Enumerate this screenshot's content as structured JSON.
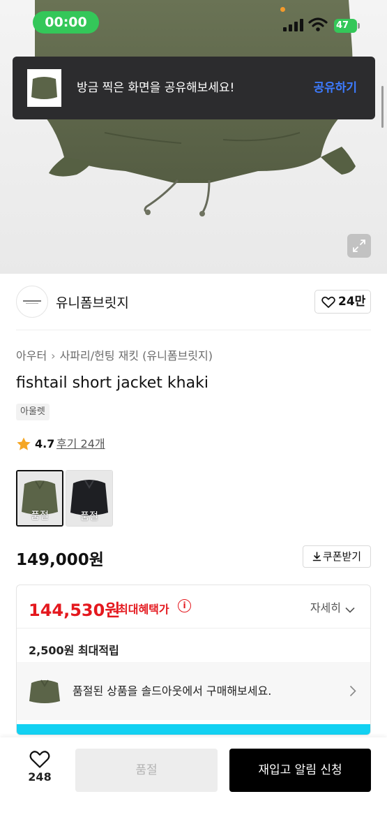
{
  "status_bar": {
    "time": "00:00",
    "battery": "47"
  },
  "toast": {
    "message": "방금 찍은 화면을 공유해보세요!",
    "action": "공유하기"
  },
  "brand": {
    "name": "유니폼브릿지",
    "likes": "24만"
  },
  "breadcrumb": [
    "아우터",
    "사파리/헌팅 재킷 (유니폼브릿지)"
  ],
  "product": {
    "title": "fishtail short jacket khaki",
    "tag": "아울렛",
    "rating": "4.7",
    "reviews": "후기 24개",
    "swatches": [
      {
        "label": "품절",
        "color": "#5b6448"
      },
      {
        "label": "품절",
        "color": "#1e1f23"
      }
    ],
    "price": "149,000원",
    "coupon_label": "쿠폰받기"
  },
  "benefit": {
    "sale_price": "144,530원",
    "sale_label": "최대혜택가",
    "detail_label": "자세히",
    "points": "2,500원 최대적립",
    "soldout_message": "품절된 상품을 솔드아웃에서 구매해보세요."
  },
  "bottom_bar": {
    "like_count": "248",
    "soldout_label": "품절",
    "restock_label": "재입고 알림 신청"
  },
  "colors": {
    "accent_red": "#e4181e",
    "toast_action_blue": "#3d7bff",
    "status_green": "#34c759",
    "strip_cyan": "#13d1f2"
  },
  "icons": [
    "signal-icon",
    "wifi-icon",
    "heart-icon",
    "star-icon",
    "info-icon",
    "chevron-down-icon",
    "chevron-right-icon",
    "download-icon",
    "expand-icon"
  ]
}
